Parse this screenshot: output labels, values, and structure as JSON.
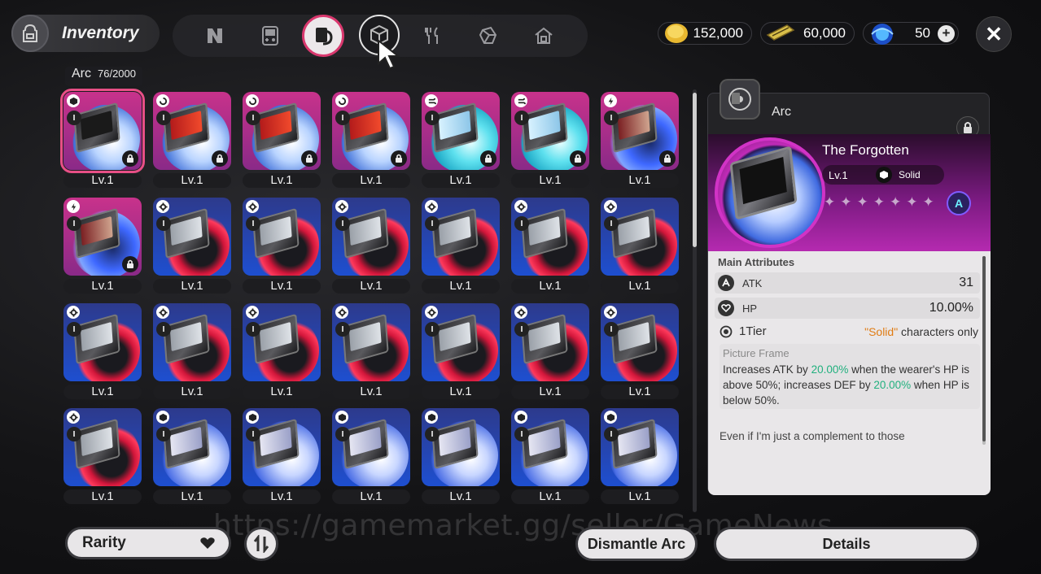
{
  "header": {
    "title": "Inventory"
  },
  "tabs": [
    {
      "icon": "n-logo-icon"
    },
    {
      "icon": "handheld-console-icon"
    },
    {
      "icon": "arc-card-icon",
      "active": true
    },
    {
      "icon": "cube-icon"
    },
    {
      "icon": "utensils-icon"
    },
    {
      "icon": "crystal-icon"
    },
    {
      "icon": "home-icon"
    }
  ],
  "currencies": [
    {
      "icon": "gold-coin-icon",
      "value": "152,000"
    },
    {
      "icon": "ticket-icon",
      "value": "60,000"
    },
    {
      "icon": "blue-orb-icon",
      "value": "50"
    }
  ],
  "grid": {
    "category": "Arc",
    "count": "76/2000",
    "level_label": "Lv.1",
    "cards": [
      {
        "rarity": "purple",
        "disc": "white",
        "art": "dark",
        "elem": "cube",
        "locked": true,
        "selected": true
      },
      {
        "rarity": "purple",
        "disc": "white",
        "art": "red",
        "elem": "swirl",
        "locked": true
      },
      {
        "rarity": "purple",
        "disc": "white",
        "art": "red",
        "elem": "swirl",
        "locked": true
      },
      {
        "rarity": "purple",
        "disc": "white",
        "art": "red",
        "elem": "swirl",
        "locked": true
      },
      {
        "rarity": "purple",
        "disc": "cyan",
        "art": "sky",
        "elem": "wind",
        "locked": true
      },
      {
        "rarity": "purple",
        "disc": "cyan",
        "art": "sky",
        "elem": "wind",
        "locked": true
      },
      {
        "rarity": "purple",
        "disc": "storm",
        "art": "face",
        "elem": "bolt",
        "locked": true
      },
      {
        "rarity": "purple",
        "disc": "storm",
        "art": "face",
        "elem": "bolt",
        "locked": true
      },
      {
        "rarity": "blue",
        "disc": "red",
        "art": "robo",
        "elem": "gear"
      },
      {
        "rarity": "blue",
        "disc": "red",
        "art": "robo",
        "elem": "gear"
      },
      {
        "rarity": "blue",
        "disc": "red",
        "art": "robo",
        "elem": "gear"
      },
      {
        "rarity": "blue",
        "disc": "red",
        "art": "robo",
        "elem": "gear"
      },
      {
        "rarity": "blue",
        "disc": "red",
        "art": "robo",
        "elem": "gear"
      },
      {
        "rarity": "blue",
        "disc": "red",
        "art": "robo",
        "elem": "gear"
      },
      {
        "rarity": "blue",
        "disc": "red",
        "art": "robo",
        "elem": "gear"
      },
      {
        "rarity": "blue",
        "disc": "red",
        "art": "robo",
        "elem": "gear"
      },
      {
        "rarity": "blue",
        "disc": "red",
        "art": "robo",
        "elem": "gear"
      },
      {
        "rarity": "blue",
        "disc": "red",
        "art": "robo",
        "elem": "gear"
      },
      {
        "rarity": "blue",
        "disc": "red",
        "art": "robo",
        "elem": "gear"
      },
      {
        "rarity": "blue",
        "disc": "red",
        "art": "robo",
        "elem": "gear"
      },
      {
        "rarity": "blue",
        "disc": "red",
        "art": "robo",
        "elem": "gear"
      },
      {
        "rarity": "blue",
        "disc": "red",
        "art": "robo",
        "elem": "gear"
      },
      {
        "rarity": "blue",
        "disc": "ice",
        "art": "sketch",
        "elem": "cube"
      },
      {
        "rarity": "blue",
        "disc": "ice",
        "art": "sketch",
        "elem": "cube"
      },
      {
        "rarity": "blue",
        "disc": "ice",
        "art": "sketch",
        "elem": "cube"
      },
      {
        "rarity": "blue",
        "disc": "ice",
        "art": "sketch",
        "elem": "cube"
      },
      {
        "rarity": "blue",
        "disc": "ice",
        "art": "sketch",
        "elem": "cube"
      },
      {
        "rarity": "blue",
        "disc": "ice",
        "art": "sketch",
        "elem": "cube"
      }
    ]
  },
  "detail": {
    "category": "Arc",
    "name": "The Forgotten",
    "level": "Lv.1",
    "attribute": "Solid",
    "stars": 7,
    "rank_icon": "A",
    "main_attributes_title": "Main Attributes",
    "stats": [
      {
        "icon": "atk-icon",
        "name": "ATK",
        "value": "31"
      },
      {
        "icon": "hp-heart-icon",
        "name": "HP",
        "value": "10.00%"
      }
    ],
    "tier": "1Tier",
    "requirement_prefix": "\"Solid\"",
    "requirement_suffix": " characters only",
    "effect_name": "Picture Frame",
    "effect_desc_1": "Increases ATK by ",
    "effect_val_1": "20.00%",
    "effect_desc_2": " when the wearer's HP is above 50%; increases DEF by ",
    "effect_val_2": "20.00%",
    "effect_desc_3": " when HP is below 50%.",
    "flavor": "Even if I'm just a complement to those masterpieces... I'm still beautiful too, right?"
  },
  "bottom": {
    "sort_label": "Rarity",
    "dismantle_label": "Dismantle Arc",
    "details_label": "Details"
  },
  "watermark": "https://gamemarket.gg/seller/GameNews",
  "colors": {
    "accent": "#e84f86",
    "purple": "#c8328b",
    "blue": "#1e4fd0",
    "green": "#21b07e",
    "orange": "#e07c14"
  }
}
